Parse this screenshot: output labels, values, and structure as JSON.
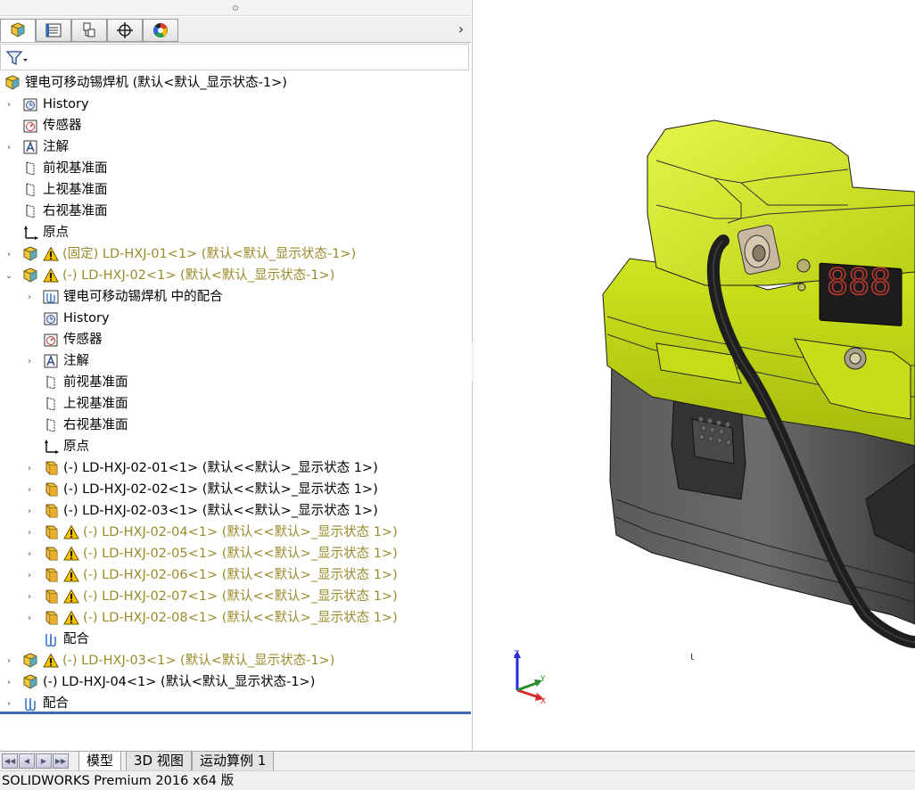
{
  "feature_manager": {
    "tabs": [
      {
        "name": "featuremanager-tab",
        "active": true
      },
      {
        "name": "propertymanager-tab",
        "active": false
      },
      {
        "name": "configurationmanager-tab",
        "active": false
      },
      {
        "name": "dimxpertmanager-tab",
        "active": false
      },
      {
        "name": "displaymanager-tab",
        "active": false
      }
    ],
    "more_label": "›"
  },
  "tree": [
    {
      "depth": 0,
      "expander": "",
      "icon": "assembly-icon",
      "warn": false,
      "label": "锂电可移动锡焊机  (默认<默认_显示状态-1>)",
      "olive": false
    },
    {
      "depth": 1,
      "expander": "›",
      "icon": "history-icon",
      "warn": false,
      "label": "History",
      "olive": false
    },
    {
      "depth": 1,
      "expander": "",
      "icon": "sensors-icon",
      "warn": false,
      "label": "传感器",
      "olive": false
    },
    {
      "depth": 1,
      "expander": "›",
      "icon": "annotations-icon",
      "warn": false,
      "label": "注解",
      "olive": false
    },
    {
      "depth": 1,
      "expander": "",
      "icon": "plane-icon",
      "warn": false,
      "label": "前视基准面",
      "olive": false
    },
    {
      "depth": 1,
      "expander": "",
      "icon": "plane-icon",
      "warn": false,
      "label": "上视基准面",
      "olive": false
    },
    {
      "depth": 1,
      "expander": "",
      "icon": "plane-icon",
      "warn": false,
      "label": "右视基准面",
      "olive": false
    },
    {
      "depth": 1,
      "expander": "",
      "icon": "origin-icon",
      "warn": false,
      "label": "原点",
      "olive": false
    },
    {
      "depth": 1,
      "expander": "›",
      "icon": "subassembly-icon",
      "warn": true,
      "label": "(固定) LD-HXJ-01<1> (默认<默认_显示状态-1>)",
      "olive": true
    },
    {
      "depth": 1,
      "expander": "⌄",
      "icon": "subassembly-icon",
      "warn": true,
      "label": "(-) LD-HXJ-02<1> (默认<默认_显示状态-1>)",
      "olive": true
    },
    {
      "depth": 2,
      "expander": "›",
      "icon": "mates-folder-icon",
      "warn": false,
      "label": "锂电可移动锡焊机 中的配合",
      "olive": false
    },
    {
      "depth": 2,
      "expander": "",
      "icon": "history-icon",
      "warn": false,
      "label": "History",
      "olive": false
    },
    {
      "depth": 2,
      "expander": "",
      "icon": "sensors-icon",
      "warn": false,
      "label": "传感器",
      "olive": false
    },
    {
      "depth": 2,
      "expander": "›",
      "icon": "annotations-icon",
      "warn": false,
      "label": "注解",
      "olive": false
    },
    {
      "depth": 2,
      "expander": "",
      "icon": "plane-icon",
      "warn": false,
      "label": "前视基准面",
      "olive": false
    },
    {
      "depth": 2,
      "expander": "",
      "icon": "plane-icon",
      "warn": false,
      "label": "上视基准面",
      "olive": false
    },
    {
      "depth": 2,
      "expander": "",
      "icon": "plane-icon",
      "warn": false,
      "label": "右视基准面",
      "olive": false
    },
    {
      "depth": 2,
      "expander": "",
      "icon": "origin-icon",
      "warn": false,
      "label": "原点",
      "olive": false
    },
    {
      "depth": 2,
      "expander": "›",
      "icon": "part-icon",
      "warn": false,
      "label": "(-) LD-HXJ-02-01<1> (默认<<默认>_显示状态 1>)",
      "olive": false
    },
    {
      "depth": 2,
      "expander": "›",
      "icon": "part-icon",
      "warn": false,
      "label": "(-) LD-HXJ-02-02<1> (默认<<默认>_显示状态 1>)",
      "olive": false
    },
    {
      "depth": 2,
      "expander": "›",
      "icon": "part-icon",
      "warn": false,
      "label": "(-) LD-HXJ-02-03<1> (默认<<默认>_显示状态 1>)",
      "olive": false
    },
    {
      "depth": 2,
      "expander": "›",
      "icon": "part-icon",
      "warn": true,
      "label": "(-) LD-HXJ-02-04<1> (默认<<默认>_显示状态 1>)",
      "olive": true
    },
    {
      "depth": 2,
      "expander": "›",
      "icon": "part-icon",
      "warn": true,
      "label": "(-) LD-HXJ-02-05<1> (默认<<默认>_显示状态 1>)",
      "olive": true
    },
    {
      "depth": 2,
      "expander": "›",
      "icon": "part-icon",
      "warn": true,
      "label": "(-) LD-HXJ-02-06<1> (默认<<默认>_显示状态 1>)",
      "olive": true
    },
    {
      "depth": 2,
      "expander": "›",
      "icon": "part-icon",
      "warn": true,
      "label": "(-) LD-HXJ-02-07<1> (默认<<默认>_显示状态 1>)",
      "olive": true
    },
    {
      "depth": 2,
      "expander": "›",
      "icon": "part-icon",
      "warn": true,
      "label": "(-) LD-HXJ-02-08<1> (默认<<默认>_显示状态 1>)",
      "olive": true
    },
    {
      "depth": 2,
      "expander": "",
      "icon": "mates-icon",
      "warn": false,
      "label": "配合",
      "olive": false
    },
    {
      "depth": 1,
      "expander": "›",
      "icon": "subassembly-icon",
      "warn": true,
      "label": "(-) LD-HXJ-03<1> (默认<默认_显示状态-1>)",
      "olive": true
    },
    {
      "depth": 1,
      "expander": "›",
      "icon": "subassembly-icon",
      "warn": false,
      "label": "(-) LD-HXJ-04<1> (默认<默认_显示状态-1>)",
      "olive": false
    },
    {
      "depth": 1,
      "expander": "›",
      "icon": "mates-icon",
      "warn": false,
      "label": "配合",
      "olive": false
    }
  ],
  "viewport": {
    "display_readout": "888",
    "triad_labels": {
      "z": "Z",
      "y": "Y",
      "x": "X"
    },
    "cursor_glyph": "ι",
    "colors": {
      "housing_green": "#d7ec2a",
      "base_dark": "#4a4a4a",
      "cable": "#1e1e1e",
      "display_red": "#c03a30"
    }
  },
  "bottom_tabs": {
    "nav_buttons": [
      "first-icon",
      "prev-icon",
      "next-icon",
      "last-icon"
    ],
    "tabs": [
      {
        "label": "模型",
        "active": true
      },
      {
        "label": "3D 视图",
        "active": false
      },
      {
        "label": "运动算例 1",
        "active": false
      }
    ]
  },
  "status_bar": {
    "text": "SOLIDWORKS Premium 2016 x64 版"
  },
  "colors": {
    "warning_text": "#9a8a2a",
    "selection_blue": "#3c6cb4"
  }
}
